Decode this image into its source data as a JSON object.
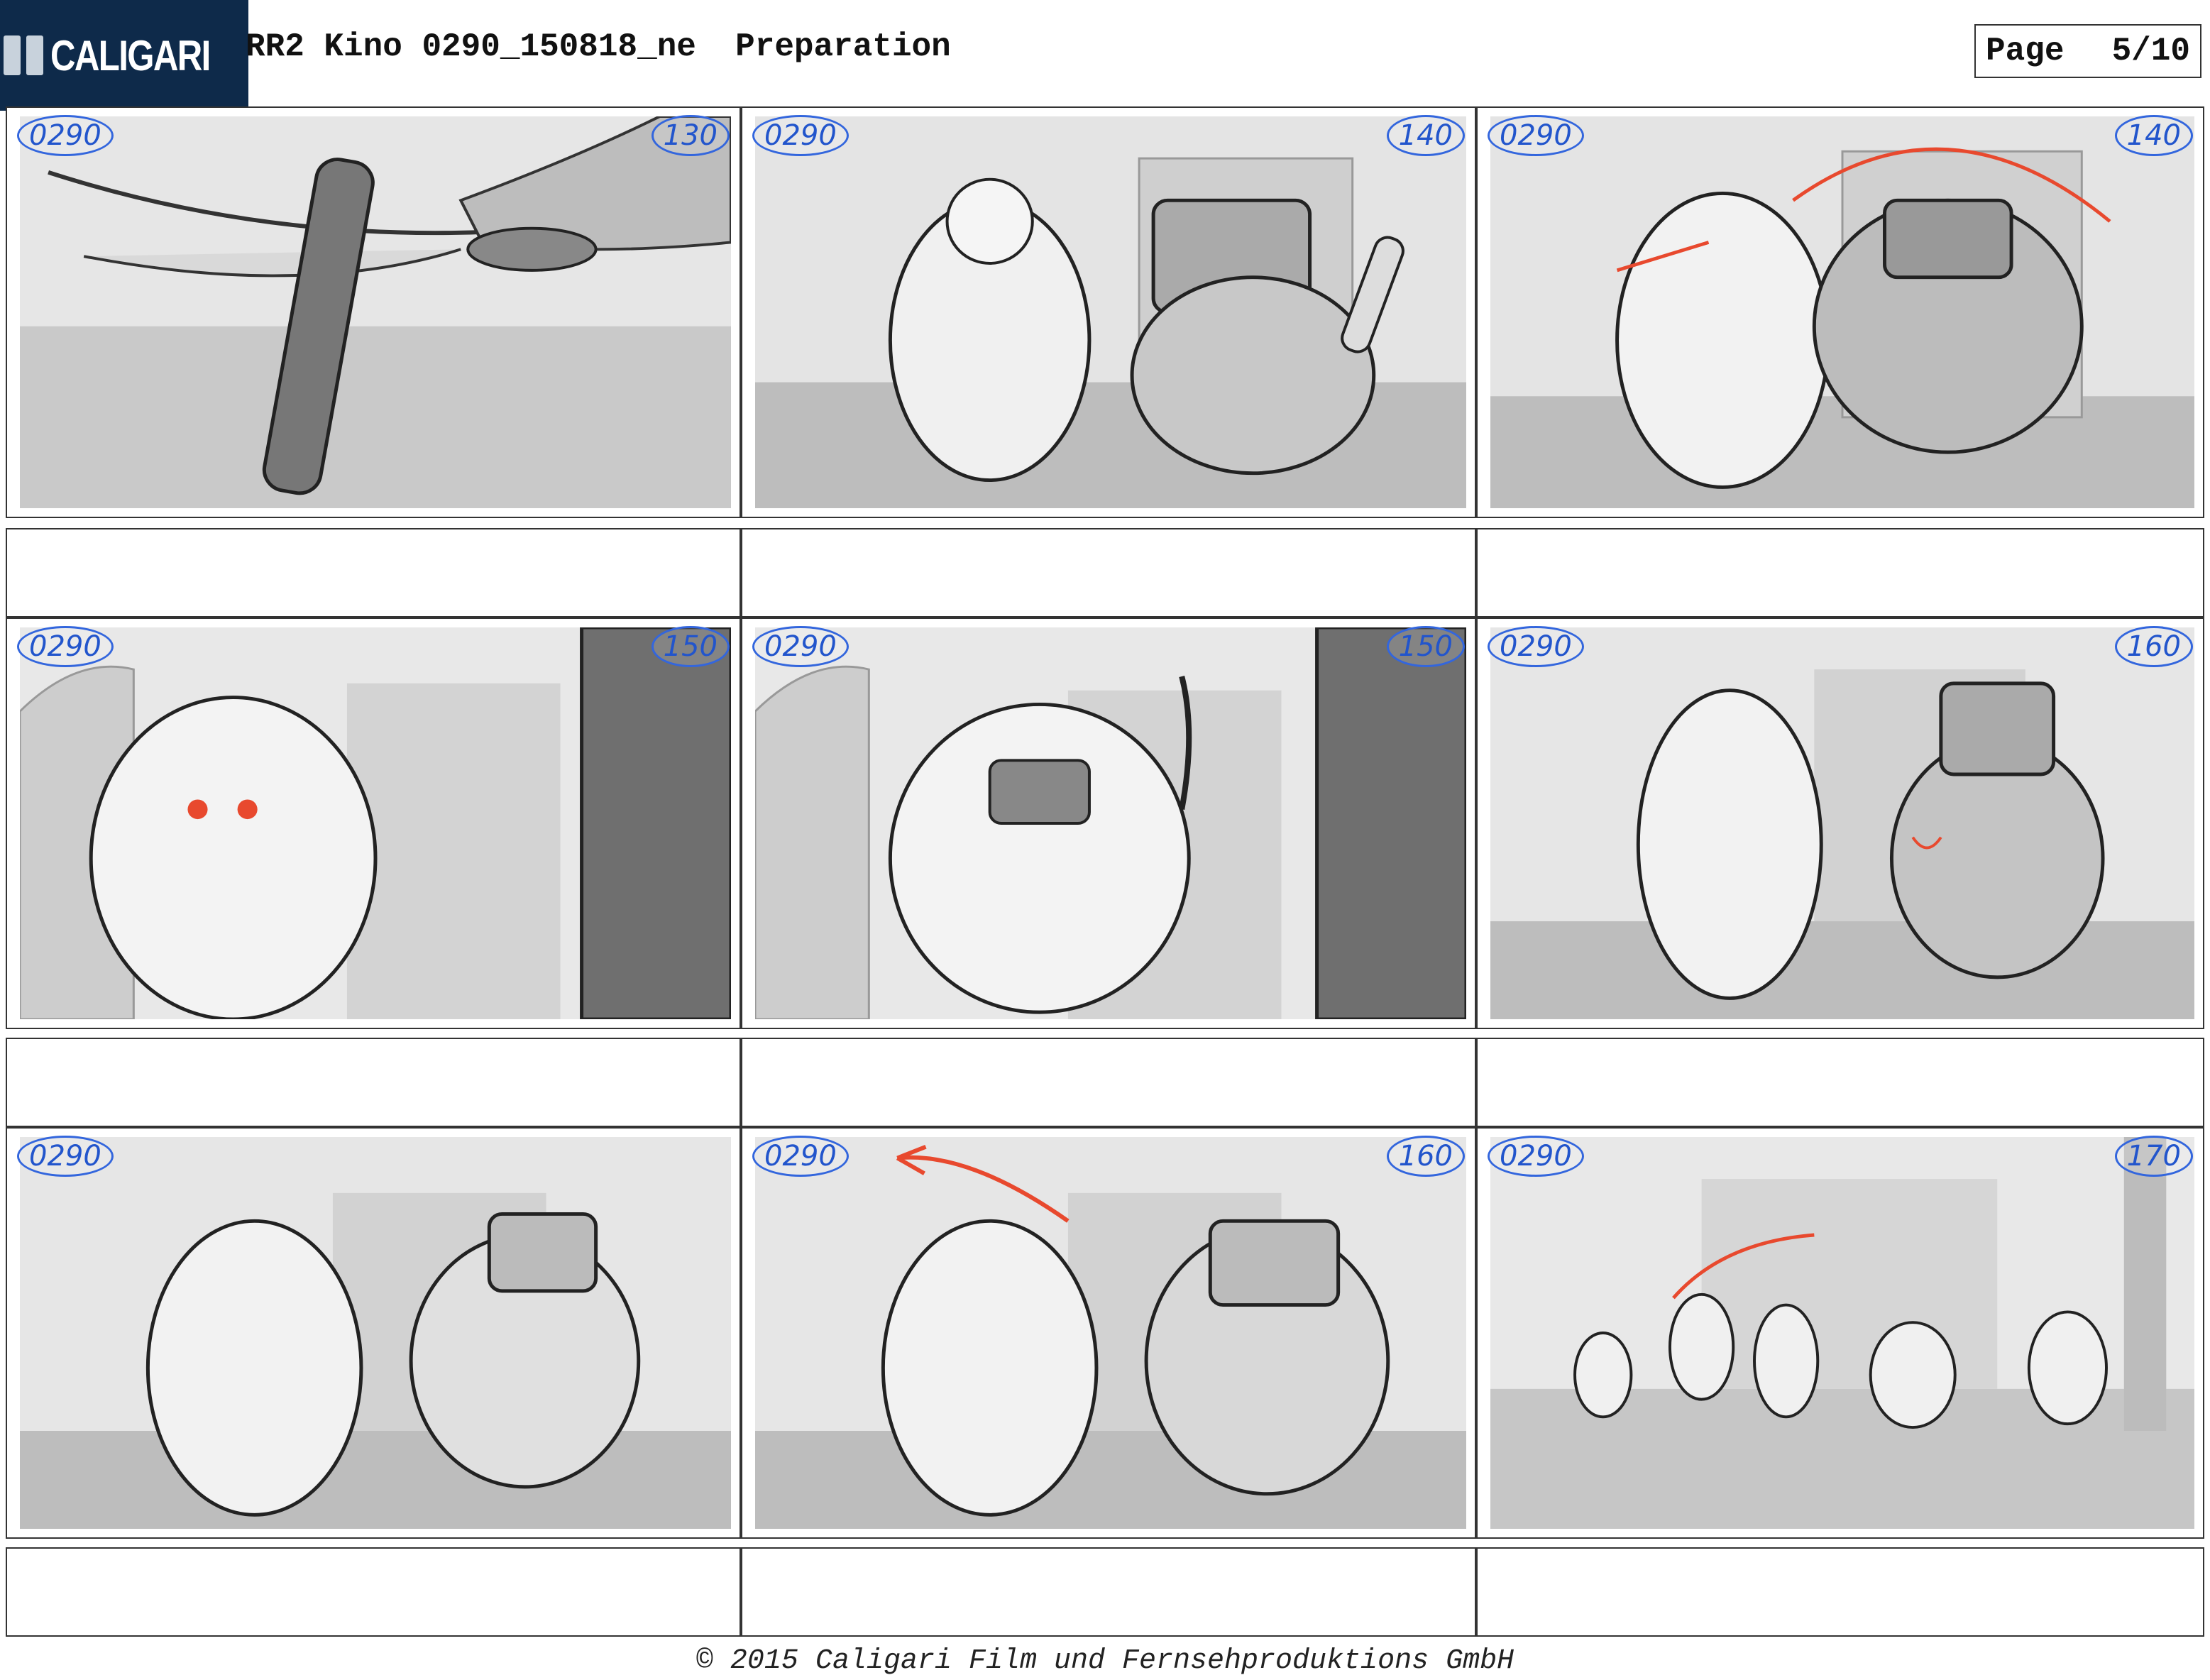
{
  "header": {
    "logo_text": "CALIGARI",
    "title": "RR2 Kino 0290_150818_ne  Preparation",
    "page_label": "Page",
    "page_number": "5/10"
  },
  "panels": [
    {
      "scene": "0290",
      "shot": "130"
    },
    {
      "scene": "0290",
      "shot": "140"
    },
    {
      "scene": "0290",
      "shot": "140"
    },
    {
      "scene": "0290",
      "shot": "150"
    },
    {
      "scene": "0290",
      "shot": "150"
    },
    {
      "scene": "0290",
      "shot": "160"
    },
    {
      "scene": "0290",
      "shot": ""
    },
    {
      "scene": "0290",
      "shot": "160"
    },
    {
      "scene": "0290",
      "shot": "170"
    }
  ],
  "footer": {
    "copyright": "© 2015 Caligari Film und Fernsehproduktions GmbH"
  },
  "colors": {
    "logo_bg": "#0e2a4a",
    "annotation_blue": "#3366dd",
    "action_arrow_red": "#e8492e"
  }
}
